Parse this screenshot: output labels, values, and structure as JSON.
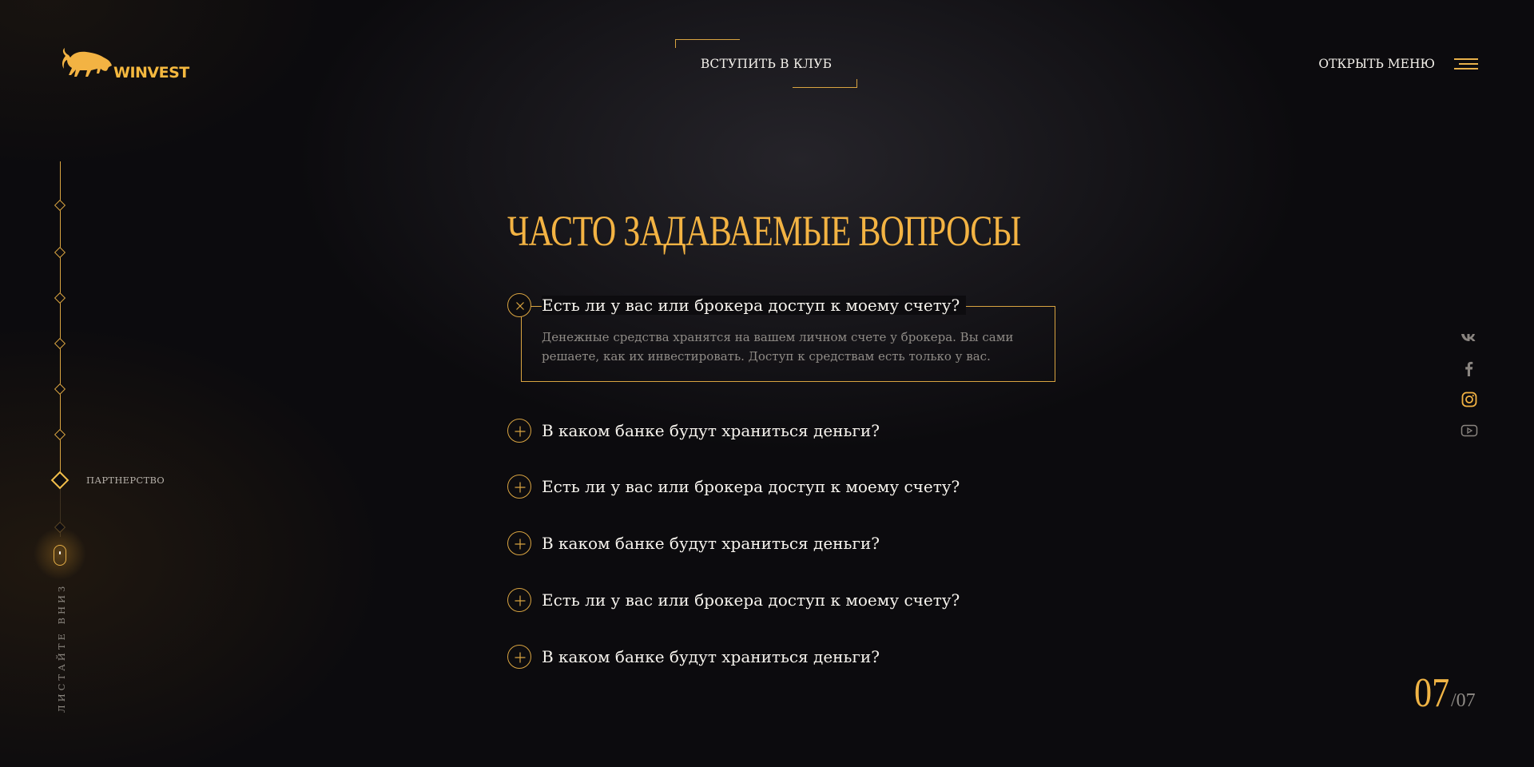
{
  "header": {
    "logo_text": "WINVEST",
    "join_label": "ВСТУПИТЬ В КЛУБ",
    "menu_label": "ОТКРЫТЬ МЕНЮ"
  },
  "colors": {
    "accent": "#f3b343",
    "background": "#0c0b0e",
    "text": "#f7f4ee",
    "muted": "#8f8b86"
  },
  "sidebar": {
    "sections_total": 8,
    "active_index": 7,
    "active_label": "ПАРТНЕРСТВО",
    "scroll_hint": "ЛИСТАЙТЕ ВНИЗ"
  },
  "faq": {
    "title": "ЧАСТО ЗАДАВАЕМЫЕ ВОПРОСЫ",
    "items": [
      {
        "question": "Есть ли у вас или брокера доступ к моему счету?",
        "expanded": true,
        "answer": "Денежные средства хранятся на вашем личном счете у брокера. Вы сами решаете, как их инвестировать. Доступ к средствам есть только у вас."
      },
      {
        "question": "В каком банке будут храниться деньги?",
        "expanded": false
      },
      {
        "question": "Есть ли у вас или брокера доступ к моему счету?",
        "expanded": false
      },
      {
        "question": "В каком банке будут храниться деньги?",
        "expanded": false
      },
      {
        "question": "Есть ли у вас или брокера доступ к моему счету?",
        "expanded": false
      },
      {
        "question": "В каком банке будут храниться деньги?",
        "expanded": false
      }
    ]
  },
  "social": [
    "vk-icon",
    "facebook-icon",
    "instagram-icon",
    "youtube-icon"
  ],
  "pager": {
    "current": "07",
    "total": "/07"
  }
}
